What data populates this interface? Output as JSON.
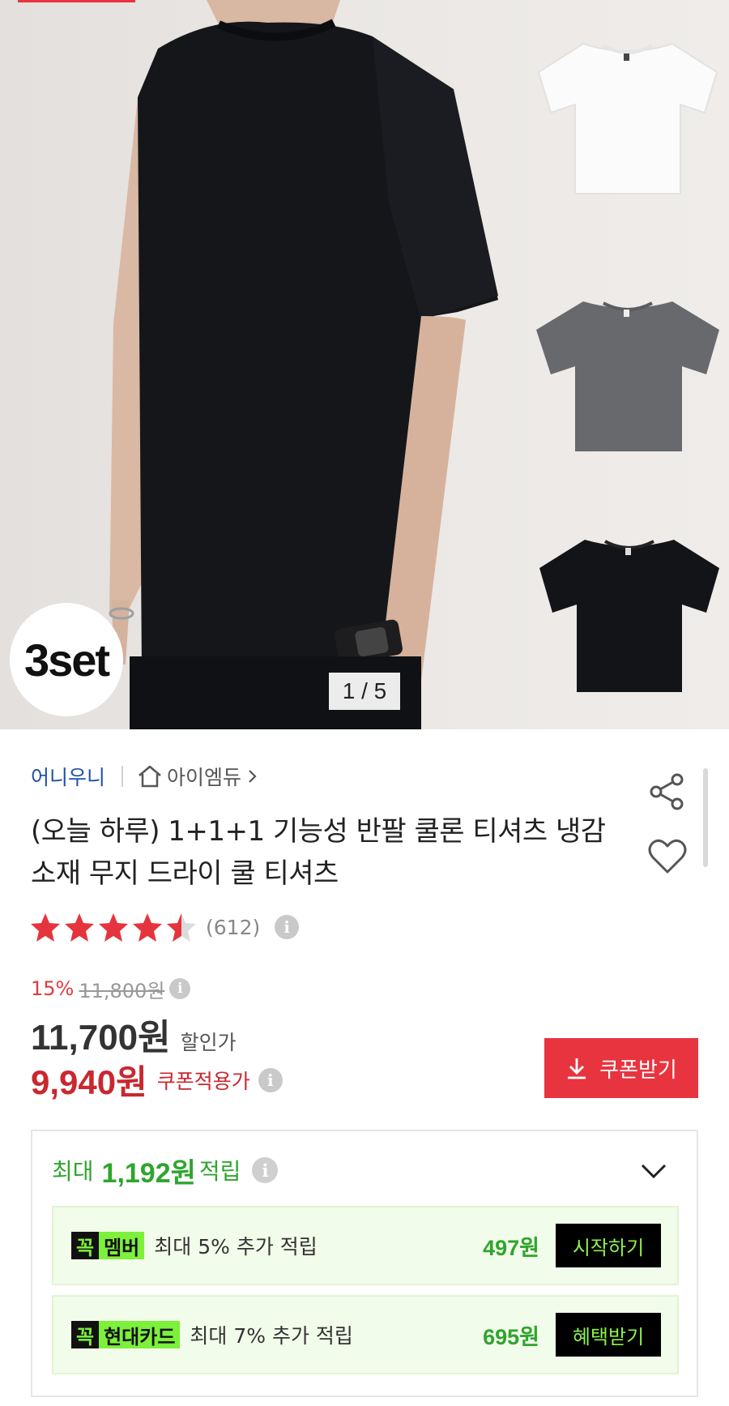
{
  "hero": {
    "badge_text": "3set",
    "page_counter": "1 / 5",
    "color_thumbs": [
      "white-tshirt",
      "gray-tshirt",
      "black-tshirt"
    ]
  },
  "seller": {
    "brand": "어니우니",
    "store": "아이엠듀"
  },
  "product": {
    "title": "(오늘 하루) 1+1+1 기능성 반팔 쿨론 티셔츠 냉감소재 무지 드라이 쿨 티셔츠",
    "rating": 4.5,
    "review_count": "(612)"
  },
  "pricing": {
    "discount_percent": "15%",
    "original_price": "11,800원",
    "sale_price": "11,700원",
    "sale_label": "할인가",
    "coupon_price": "9,940원",
    "coupon_label": "쿠폰적용가",
    "coupon_button": "쿠폰받기"
  },
  "rewards": {
    "head_prefix": "최대",
    "head_amount": "1,192원",
    "head_suffix": "적립",
    "items": [
      {
        "badge_kk": "꼭",
        "badge_name": "멤버",
        "desc": "최대 5% 추가 적립",
        "amount": "497원",
        "button": "시작하기"
      },
      {
        "badge_kk": "꼭",
        "badge_name": "현대카드",
        "desc": "최대 7% 추가 적립",
        "amount": "695원",
        "button": "혜택받기"
      }
    ]
  },
  "colors": {
    "accent_red": "#e8343f",
    "price_red": "#c9282f",
    "reward_green": "#2fa52e",
    "seller_blue": "#1e4fa6"
  }
}
